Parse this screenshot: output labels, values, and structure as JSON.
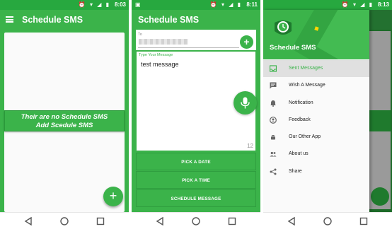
{
  "status": {
    "screen1_time": "8:03",
    "screen2_time": "8:11",
    "screen3_time": "8:13"
  },
  "screen1": {
    "title": "Schedule SMS",
    "empty_line1": "Their are no Schedule SMS",
    "empty_line2": "Add Scedule SMS",
    "fab_label": "+"
  },
  "screen2": {
    "title": "Schedule SMS",
    "to_label": "To",
    "add_label": "+",
    "message_label": "Type Your Message",
    "message_text": "test message",
    "char_count": "12",
    "pick_date": "PICK A DATE",
    "pick_time": "PICK A TIME",
    "schedule": "SCHEDULE MESSAGE"
  },
  "screen3": {
    "drawer_title": "Schedule SMS",
    "menu": [
      {
        "label": "Sent Messages",
        "icon": "inbox-icon"
      },
      {
        "label": "Wish A Message",
        "icon": "message-icon"
      },
      {
        "label": "Notification",
        "icon": "bell-icon"
      },
      {
        "label": "Feedback",
        "icon": "feedback-icon"
      },
      {
        "label": "Our Other App",
        "icon": "android-icon"
      },
      {
        "label": "About us",
        "icon": "people-icon"
      },
      {
        "label": "Share",
        "icon": "share-icon"
      }
    ]
  },
  "colors": {
    "primary": "#3bb34a",
    "status_bar": "#27a83f",
    "active_item_bg": "#e0e0e0"
  }
}
